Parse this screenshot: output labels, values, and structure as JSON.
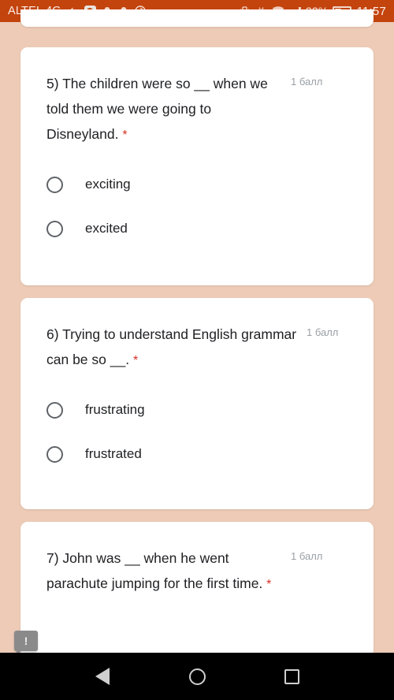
{
  "status_bar": {
    "carrier": "ALTEL 4G",
    "battery_percent": "32%",
    "time": "11:57",
    "icons": [
      "volume-icon",
      "shield-app-icon",
      "alarm-icon",
      "alarm-icon",
      "browser-icon",
      "more-icon",
      "vibrate-icon",
      "eye-care-icon",
      "wifi-icon",
      "signal-icon",
      "battery-icon"
    ]
  },
  "colors": {
    "status_bar": "#C4440E",
    "page_background": "#EDCBB7",
    "card": "#FFFFFF",
    "required_asterisk": "#D93025",
    "points_text": "#9AA0A6",
    "question_text": "#202124",
    "radio_border": "#5F6368",
    "nav_bar": "#000000"
  },
  "questions": [
    {
      "number": "5)",
      "text": "5) The children were so __ when we told them we were going to Disneyland.",
      "required_marker": "*",
      "points": "1 балл",
      "options": [
        {
          "label": "exciting",
          "selected": false
        },
        {
          "label": "excited",
          "selected": false
        }
      ]
    },
    {
      "number": "6)",
      "text": "6) Trying to understand English grammar can be so __.",
      "required_marker": "*",
      "points": "1 балл",
      "options": [
        {
          "label": "frustrating",
          "selected": false
        },
        {
          "label": "frustrated",
          "selected": false
        }
      ]
    },
    {
      "number": "7)",
      "text": "7) John was __ when he went parachute jumping for the first time.",
      "required_marker": "*",
      "points": "1 балл",
      "options": []
    }
  ],
  "feedback_badge": {
    "glyph": "!",
    "name": "feedback-bubble"
  },
  "nav_bar": {
    "back": "back-button",
    "home": "home-button",
    "recents": "recents-button"
  }
}
